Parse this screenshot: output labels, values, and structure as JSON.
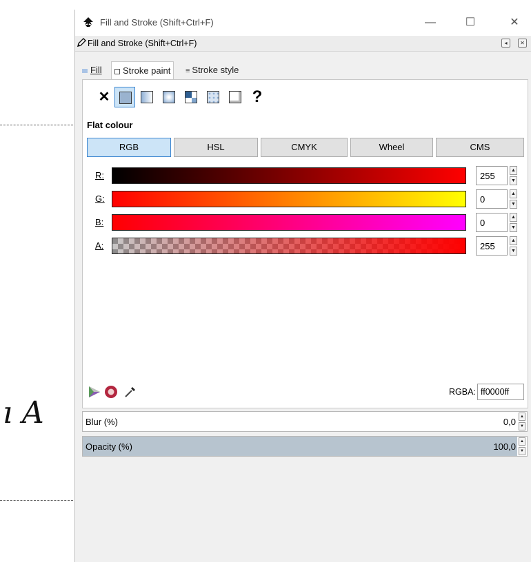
{
  "canvas": {
    "text": "ı A"
  },
  "window": {
    "title": "Fill and Stroke (Shift+Ctrl+F)",
    "minimize": "—",
    "maximize": "☐",
    "close": "✕"
  },
  "dock": {
    "title": "Fill and Stroke (Shift+Ctrl+F)",
    "btn_left": "◂",
    "btn_close": "✕"
  },
  "tabs": [
    {
      "label": "Fill"
    },
    {
      "label": "Stroke paint"
    },
    {
      "label": "Stroke style"
    }
  ],
  "paint_modes": [
    {
      "name": "no-paint",
      "glyph": "✕"
    },
    {
      "name": "flat-colour",
      "selected": true
    },
    {
      "name": "linear-gradient"
    },
    {
      "name": "radial-gradient"
    },
    {
      "name": "pattern"
    },
    {
      "name": "swatch"
    },
    {
      "name": "unset"
    },
    {
      "name": "unknown",
      "glyph": "?"
    }
  ],
  "section_title": "Flat colour",
  "color_modes": [
    "RGB",
    "HSL",
    "CMYK",
    "Wheel",
    "CMS"
  ],
  "active_color_mode": "RGB",
  "channels": [
    {
      "label": "R:",
      "value": "255"
    },
    {
      "label": "G:",
      "value": "0"
    },
    {
      "label": "B:",
      "value": "0"
    },
    {
      "label": "A:",
      "value": "255"
    }
  ],
  "rgba": {
    "label": "RGBA:",
    "value": "ff0000ff"
  },
  "blur": {
    "label": "Blur (%)",
    "value": "0,0"
  },
  "opacity": {
    "label": "Opacity (%)",
    "value": "100,0",
    "fill_fraction": 1.0
  },
  "colors": {
    "selected_bg": "#cce4f7",
    "selected_border": "#3c86d0",
    "current": "#ff0000"
  }
}
